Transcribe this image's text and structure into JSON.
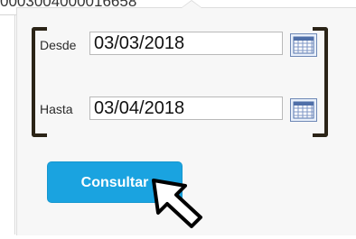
{
  "background_row": {
    "text": "0003004000016658"
  },
  "filter": {
    "desde_label": "Desde",
    "desde_value": "03/03/2018",
    "hasta_label": "Hasta",
    "hasta_value": "03/04/2018"
  },
  "actions": {
    "consultar_label": "Consultar"
  },
  "colors": {
    "accent": "#1aa3e0",
    "bracket": "#2b2417",
    "calendar": "#6d87b5"
  },
  "icons": [
    "calendar-icon",
    "calendar-icon",
    "mouse-pointer-icon"
  ]
}
